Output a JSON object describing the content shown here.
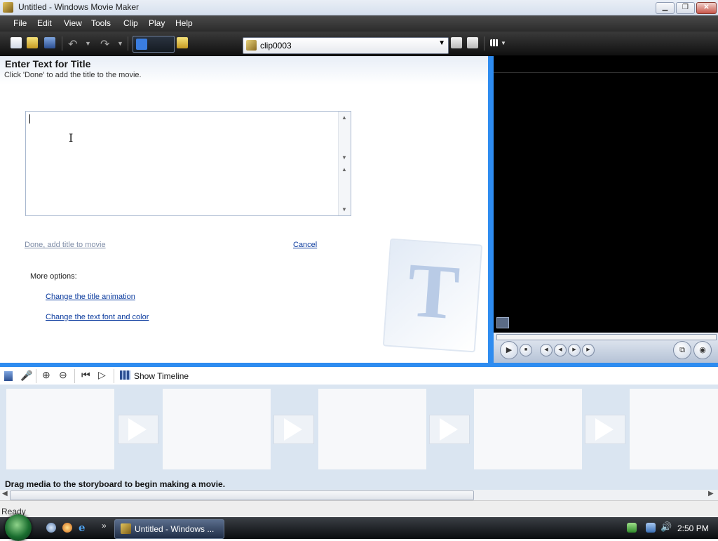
{
  "window": {
    "title": "Untitled - Windows Movie Maker",
    "minimize": "▁",
    "restore": "❐",
    "close": "✕"
  },
  "menu": [
    "File",
    "Edit",
    "View",
    "Tools",
    "Clip",
    "Play",
    "Help"
  ],
  "toolbar": {
    "clip_value": "clip0003",
    "icons": [
      "new-project-icon",
      "open-project-icon",
      "save-icon",
      "undo-icon",
      "redo-icon",
      "tasks-icon",
      "collections-icon",
      "view-options-icon"
    ]
  },
  "tasks_pane": {
    "title": "Enter Text for Title",
    "subtitle": "Click 'Done' to add the title to the movie.",
    "done_link": "Done, add title to movie",
    "cancel_link": "Cancel",
    "more_options": "More options:",
    "option_animation": "Change the title animation",
    "option_font": "Change the text font and color",
    "watermark_letter": "T"
  },
  "storyboard": {
    "show_timeline": "Show Timeline",
    "hint": "Drag media to the storyboard to begin making a movie."
  },
  "status": {
    "text": "Ready"
  },
  "taskbar": {
    "task_label": "Untitled - Windows ...",
    "clock": "2:50 PM",
    "more": "»"
  }
}
